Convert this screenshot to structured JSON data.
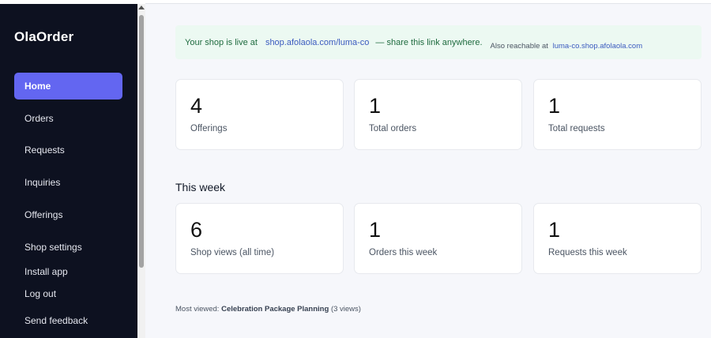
{
  "sidebar": {
    "brand": "OlaOrder",
    "items": [
      {
        "label": "Home",
        "active": true
      },
      {
        "label": "Orders",
        "active": false
      },
      {
        "label": "Requests",
        "active": false
      },
      {
        "label": "Inquiries",
        "active": false
      },
      {
        "label": "Offerings",
        "active": false
      },
      {
        "label": "Shop settings",
        "active": false
      },
      {
        "label": "Install app",
        "active": false
      },
      {
        "label": "Log out",
        "active": false
      },
      {
        "label": "Send feedback",
        "active": false
      }
    ]
  },
  "banner": {
    "prefix": "Your shop is live at",
    "url": "shop.afolaola.com/luma-co",
    "suffix": "— share this link anywhere.",
    "alt_prefix": "Also reachable at",
    "alt_url": "luma-co.shop.afolaola.com"
  },
  "stats": [
    {
      "value": "4",
      "label": "Offerings"
    },
    {
      "value": "1",
      "label": "Total orders"
    },
    {
      "value": "1",
      "label": "Total requests"
    }
  ],
  "week": {
    "title": "This week",
    "stats": [
      {
        "value": "6",
        "label": "Shop views (all time)"
      },
      {
        "value": "1",
        "label": "Orders this week"
      },
      {
        "value": "1",
        "label": "Requests this week"
      }
    ]
  },
  "most_viewed": {
    "prefix": "Most viewed:",
    "item": "Celebration Package Planning",
    "views": "(3 views)"
  },
  "colors": {
    "sidebar_bg": "#0d1120",
    "active_nav": "#6366f1",
    "banner_bg": "#ecf9f2",
    "link": "#3b5bbf"
  }
}
